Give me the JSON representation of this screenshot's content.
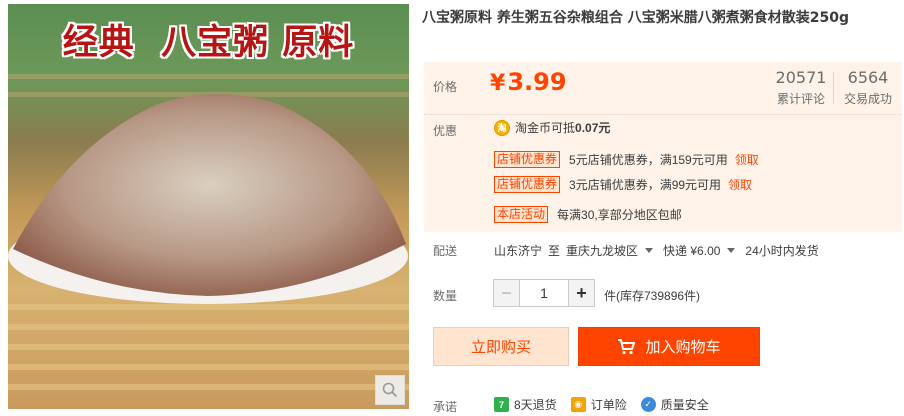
{
  "product": {
    "image_headline": "经典  八宝粥 原料",
    "title": "八宝粥原料 养生粥五谷杂粮组合 八宝粥米腊八粥煮粥食材散装250g"
  },
  "price": {
    "label": "价格",
    "currency": "¥",
    "amount": "3.99",
    "reviews_count": "20571",
    "reviews_label": "累计评论",
    "sales_count": "6564",
    "sales_label": "交易成功"
  },
  "promotions": {
    "label": "优惠",
    "coin_text": "淘金币可抵",
    "coin_amount": "0.07元",
    "coupons": [
      {
        "tag": "店铺优惠券",
        "text": "5元店铺优惠券，满159元可用",
        "action": "领取"
      },
      {
        "tag": "店铺优惠券",
        "text": "3元店铺优惠券，满99元可用",
        "action": "领取"
      }
    ],
    "activity_tag": "本店活动",
    "activity_text": "每满30,享部分地区包邮"
  },
  "delivery": {
    "label": "配送",
    "origin": "山东济宁",
    "to": "至",
    "destination": "重庆九龙坡区",
    "shipping": "快递 ¥6.00",
    "dispatch": "24小时内发货"
  },
  "quantity": {
    "label": "数量",
    "value": "1",
    "minus": "−",
    "plus": "+",
    "stock": "件(库存739896件)"
  },
  "actions": {
    "buy_now": "立即购买",
    "add_to_cart": "加入购物车"
  },
  "promises": {
    "label": "承诺",
    "items": [
      "8天退货",
      "订单险",
      "质量安全"
    ]
  },
  "colors": {
    "accent": "#ff4400",
    "panel_bg": "#fff2e8",
    "buy_now_bg": "#ffe4d0"
  }
}
